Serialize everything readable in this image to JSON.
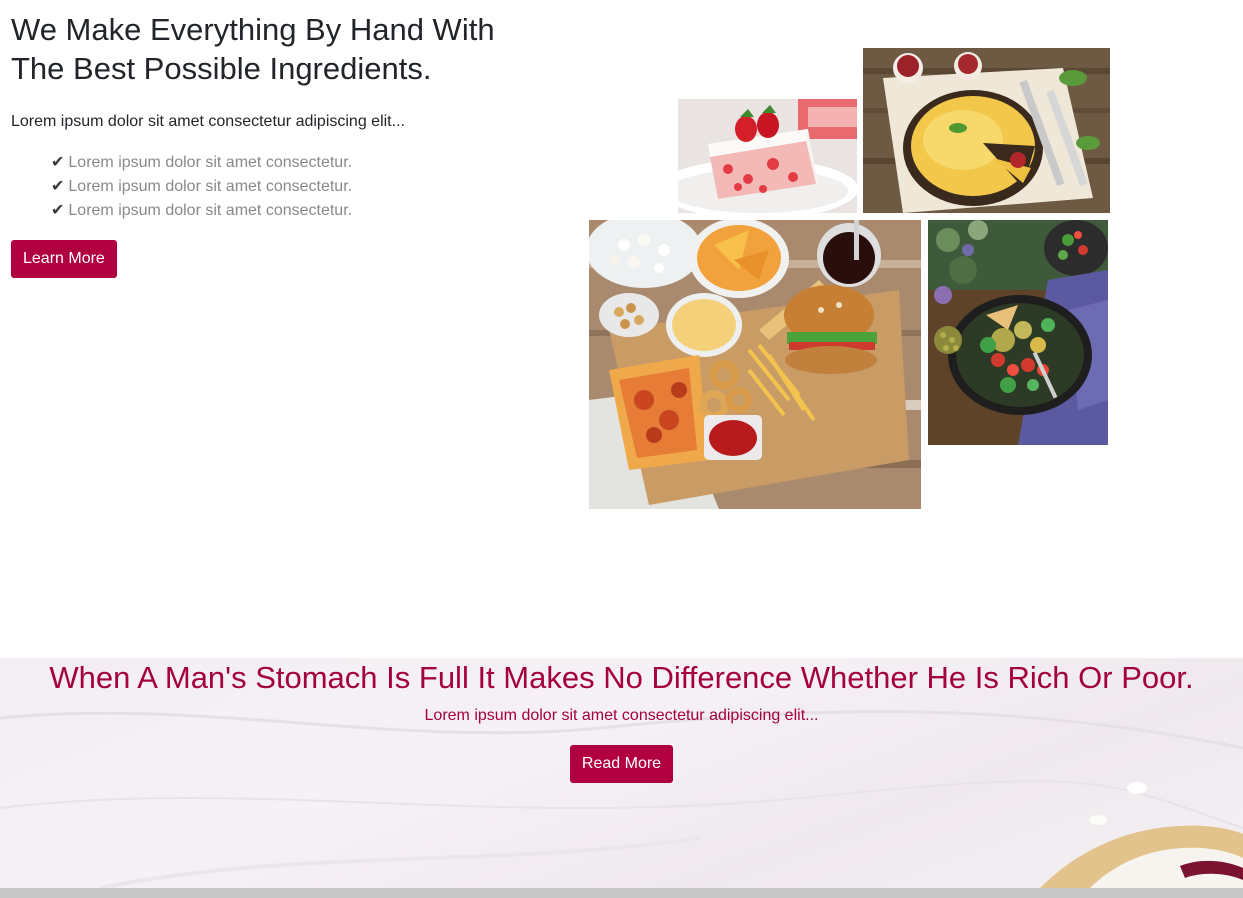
{
  "about": {
    "title_line1": "We Make Everything By Hand With",
    "title_line2": "The Best Possible Ingredients.",
    "lead": "Lorem ipsum dolor sit amet consectetur adipiscing elit...",
    "checklist": [
      {
        "icon": "✔",
        "text": "Lorem ipsum dolor sit amet consectetur."
      },
      {
        "icon": "✔",
        "text": "Lorem ipsum dolor sit amet consectetur."
      },
      {
        "icon": "✔",
        "text": "Lorem ipsum dolor sit amet consectetur."
      }
    ],
    "button_label": "Learn More"
  },
  "quote": {
    "title": "When A Man's Stomach Is Full It Makes No Difference Whether He Is Rich Or Poor.",
    "subtitle": "Lorem ipsum dolor sit amet consectetur adipiscing elit...",
    "button_label": "Read More"
  },
  "colors": {
    "accent": "#b1003f",
    "quote_text": "#a4003b",
    "muted_text": "#8a8a8a"
  }
}
